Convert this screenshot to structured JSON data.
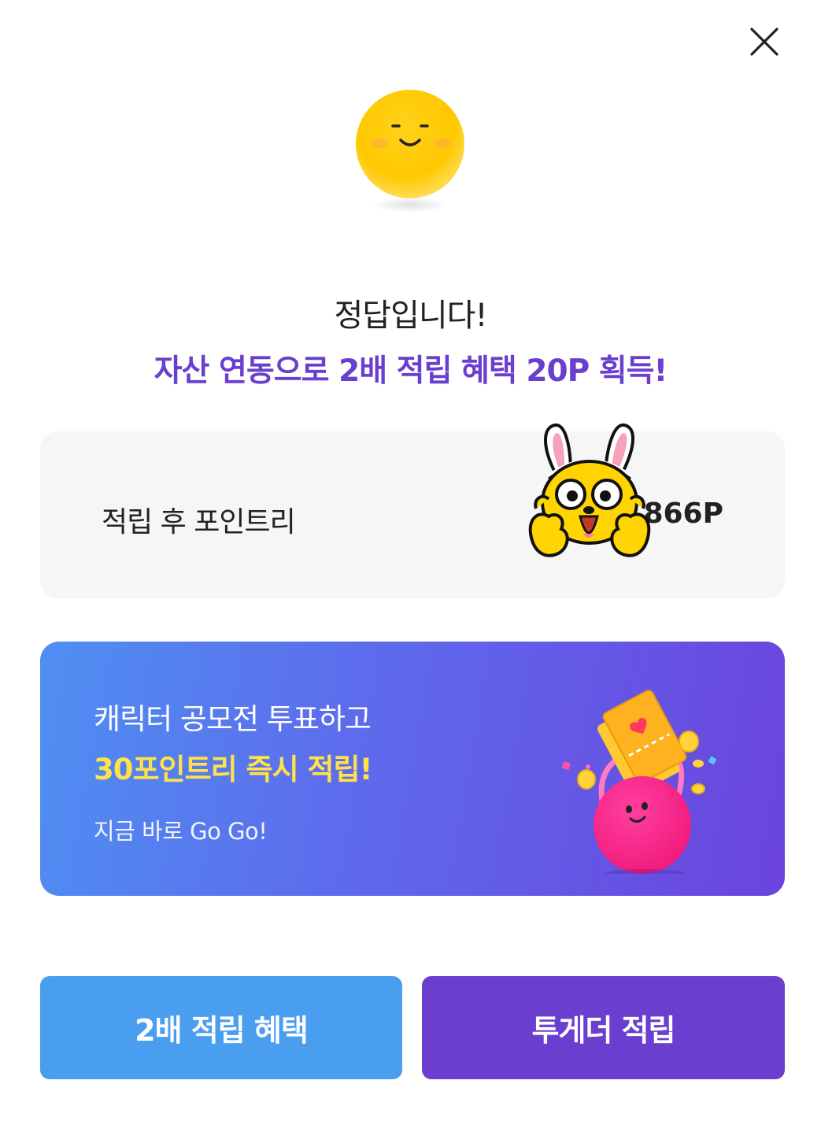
{
  "dialog": {
    "close_icon": "close-icon",
    "emoji_icon": "smiling-face-icon",
    "title": "정답입니다!",
    "subtitle": "자산 연동으로 2배 적립 혜택 20P 획득!"
  },
  "points_card": {
    "label": "적립 후 포인트리",
    "value": ",866P",
    "mascot_icon": "rabbit-ear-mascot-icon"
  },
  "banner": {
    "line1": "캐릭터 공모전 투표하고",
    "line2": "30포인트리 즉시 적립!",
    "line3": "지금 바로 Go Go!",
    "art_icon": "ticket-bag-character-icon",
    "colors": {
      "highlight": "#ffe14a",
      "gradient_start": "#4f8ff2",
      "gradient_end": "#6b44dd"
    }
  },
  "buttons": {
    "left_label": "2배 적립 혜택",
    "right_label": "투게더 적립",
    "colors": {
      "left": "#4a9ef0",
      "right": "#6a3fcf"
    }
  },
  "colors": {
    "accent": "#6a3fcf"
  }
}
